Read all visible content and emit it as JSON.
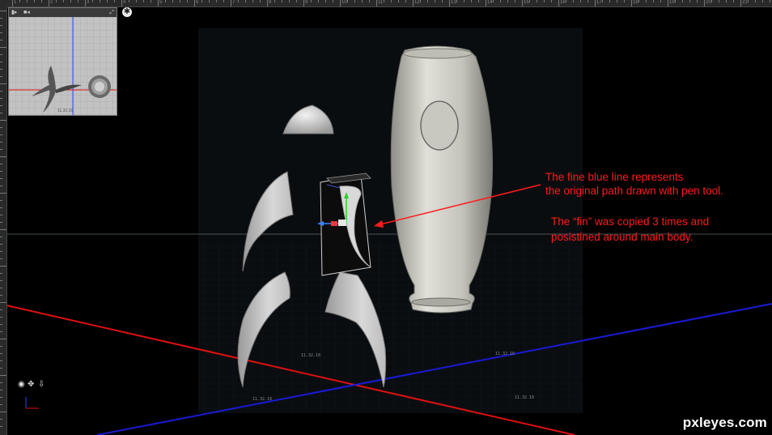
{
  "ruler": {
    "numbers": [
      "1",
      "2",
      "3",
      "4",
      "5",
      "6",
      "7",
      "8",
      "9",
      "10",
      "11",
      "12",
      "13",
      "14",
      "15",
      "16",
      "17",
      "18",
      "19",
      "20",
      "21"
    ]
  },
  "navigator": {
    "panel_icon": "panel-icon",
    "camera_icon": "camera-icon",
    "expand_icon": "expand-icon",
    "scale_label": "11.32.16"
  },
  "viewport": {
    "star_button": "✱",
    "floor_label_1": "11.32.16",
    "floor_label_2": "11.32.16",
    "floor_label_3": "11.32.16",
    "floor_label_4": "11.32.16"
  },
  "annotations": {
    "line1": "The fine blue line represents",
    "line2": "the original path drawn with pen tool.",
    "line3": "The “fin” was copied 3 times and",
    "line4": "posistined around main body."
  },
  "watermark": "pxleyes.com",
  "colors": {
    "annotation": "#ff1b1b",
    "x_axis": "#e01010",
    "z_axis": "#1a1ad8",
    "model": "#d0d0c8"
  },
  "gizmo_icons": [
    "orbit-icon",
    "pan-icon",
    "walk-icon"
  ]
}
